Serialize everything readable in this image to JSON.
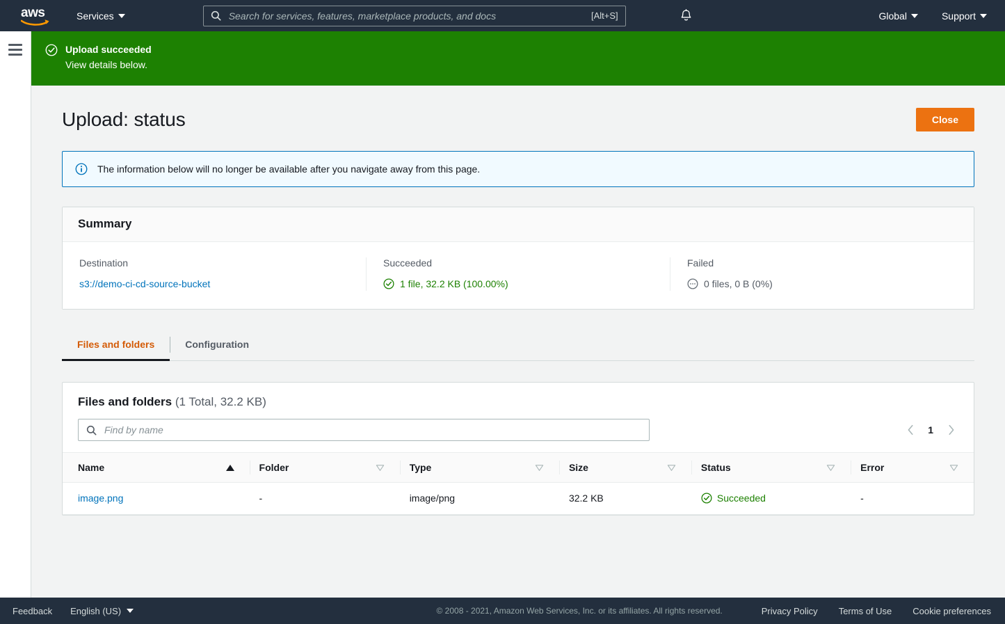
{
  "topnav": {
    "logo_text": "aws",
    "services_label": "Services",
    "search_placeholder": "Search for services, features, marketplace products, and docs",
    "search_value": "",
    "search_shortcut": "[Alt+S]",
    "bell_icon": "bell-icon",
    "region_label": "Global",
    "support_label": "Support"
  },
  "flashbar": {
    "icon": "status-success-icon",
    "title": "Upload succeeded",
    "subtitle": "View details below.",
    "background_color": "#1d8102"
  },
  "header": {
    "title": "Upload: status",
    "close_label": "Close",
    "close_color": "#ec7211"
  },
  "alert": {
    "icon": "info-circle-icon",
    "message": "The information below will no longer be available after you navigate away from this page.",
    "border_color": "#0073bb",
    "background_color": "#f1faff"
  },
  "summary": {
    "heading": "Summary",
    "cells": [
      {
        "label": "Destination",
        "value": "s3://demo-ci-cd-source-bucket",
        "kind": "link"
      },
      {
        "label": "Succeeded",
        "value": "1 file, 32.2 KB (100.00%)",
        "kind": "success",
        "icon": "status-success-icon"
      },
      {
        "label": "Failed",
        "value": "0 files, 0 B (0%)",
        "kind": "muted",
        "icon": "status-pending-icon"
      }
    ]
  },
  "tabs": [
    {
      "label": "Files and folders",
      "active": true
    },
    {
      "label": "Configuration",
      "active": false
    }
  ],
  "files_panel": {
    "title": "Files and folders",
    "count_text": "(1 Total, 32.2 KB)",
    "search_placeholder": "Find by name",
    "search_value": "",
    "pagination": {
      "prev_icon": "chevron-left-icon",
      "page": "1",
      "next_icon": "chevron-right-icon"
    },
    "columns": [
      {
        "label": "Name",
        "sort": "asc"
      },
      {
        "label": "Folder",
        "sort": "none"
      },
      {
        "label": "Type",
        "sort": "none"
      },
      {
        "label": "Size",
        "sort": "none"
      },
      {
        "label": "Status",
        "sort": "none"
      },
      {
        "label": "Error",
        "sort": "none"
      }
    ],
    "rows": [
      {
        "name": "image.png",
        "folder": "-",
        "type": "image/png",
        "size": "32.2 KB",
        "status": "Succeeded",
        "error": "-"
      }
    ]
  },
  "footer": {
    "feedback_label": "Feedback",
    "language_label": "English (US)",
    "copyright": "© 2008 - 2021, Amazon Web Services, Inc. or its affiliates. All rights reserved.",
    "links": [
      "Privacy Policy",
      "Terms of Use",
      "Cookie preferences"
    ]
  }
}
